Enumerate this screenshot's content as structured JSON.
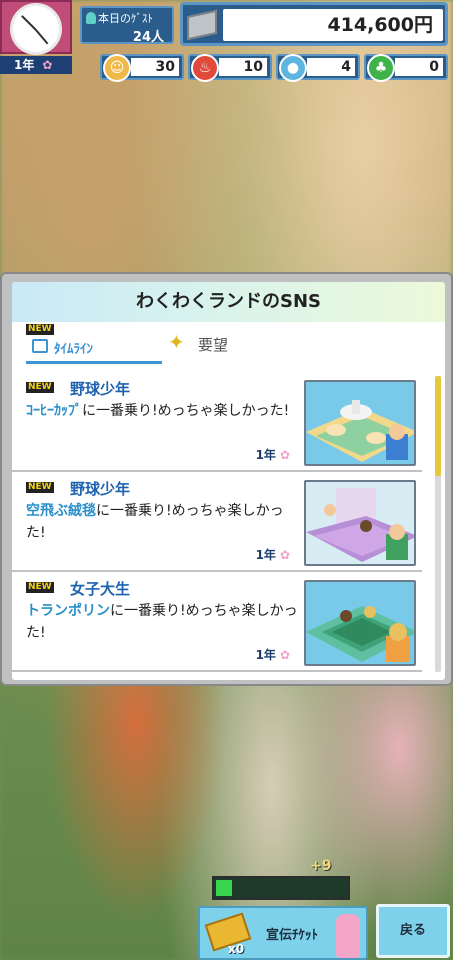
{
  "hud": {
    "year_label": "1年",
    "guests_label": "本日のｹﾞｽﾄ",
    "guests_value": "24人",
    "money": "414,600円",
    "stats": [
      {
        "icon": "smiley-icon",
        "value": "30",
        "color": "#f0b94a"
      },
      {
        "icon": "fire-icon",
        "value": "10",
        "color": "#e04a3a"
      },
      {
        "icon": "water-drop-icon",
        "value": "4",
        "color": "#5eb6e0"
      },
      {
        "icon": "leaf-icon",
        "value": "0",
        "color": "#3fb24a"
      }
    ]
  },
  "sns": {
    "title": "わくわくランドのSNS",
    "tabs": {
      "timeline_new": "NEW",
      "timeline": "ﾀｲﾑﾗｲﾝ",
      "requests": "要望"
    },
    "posts": [
      {
        "new": "NEW",
        "poster": "野球少年",
        "attraction": "ｺｰﾋｰｶｯﾌﾟ",
        "message": "に一番乗り!めっちゃ楽しかった!",
        "date": "1年"
      },
      {
        "new": "NEW",
        "poster": "野球少年",
        "attraction": "空飛ぶ絨毯",
        "message": "に一番乗り!めっちゃ楽しかった!",
        "date": "1年"
      },
      {
        "new": "NEW",
        "poster": "女子大生",
        "attraction": "トランポリン",
        "message": "に一番乗り!めっちゃ楽しかった!",
        "date": "1年"
      }
    ]
  },
  "bottom": {
    "progress_plus": "+9",
    "progress_fraction": 0.12,
    "ticket_count": "x0",
    "ticket_label": "宣伝ﾁｹｯﾄ",
    "back_label": "戻る"
  }
}
